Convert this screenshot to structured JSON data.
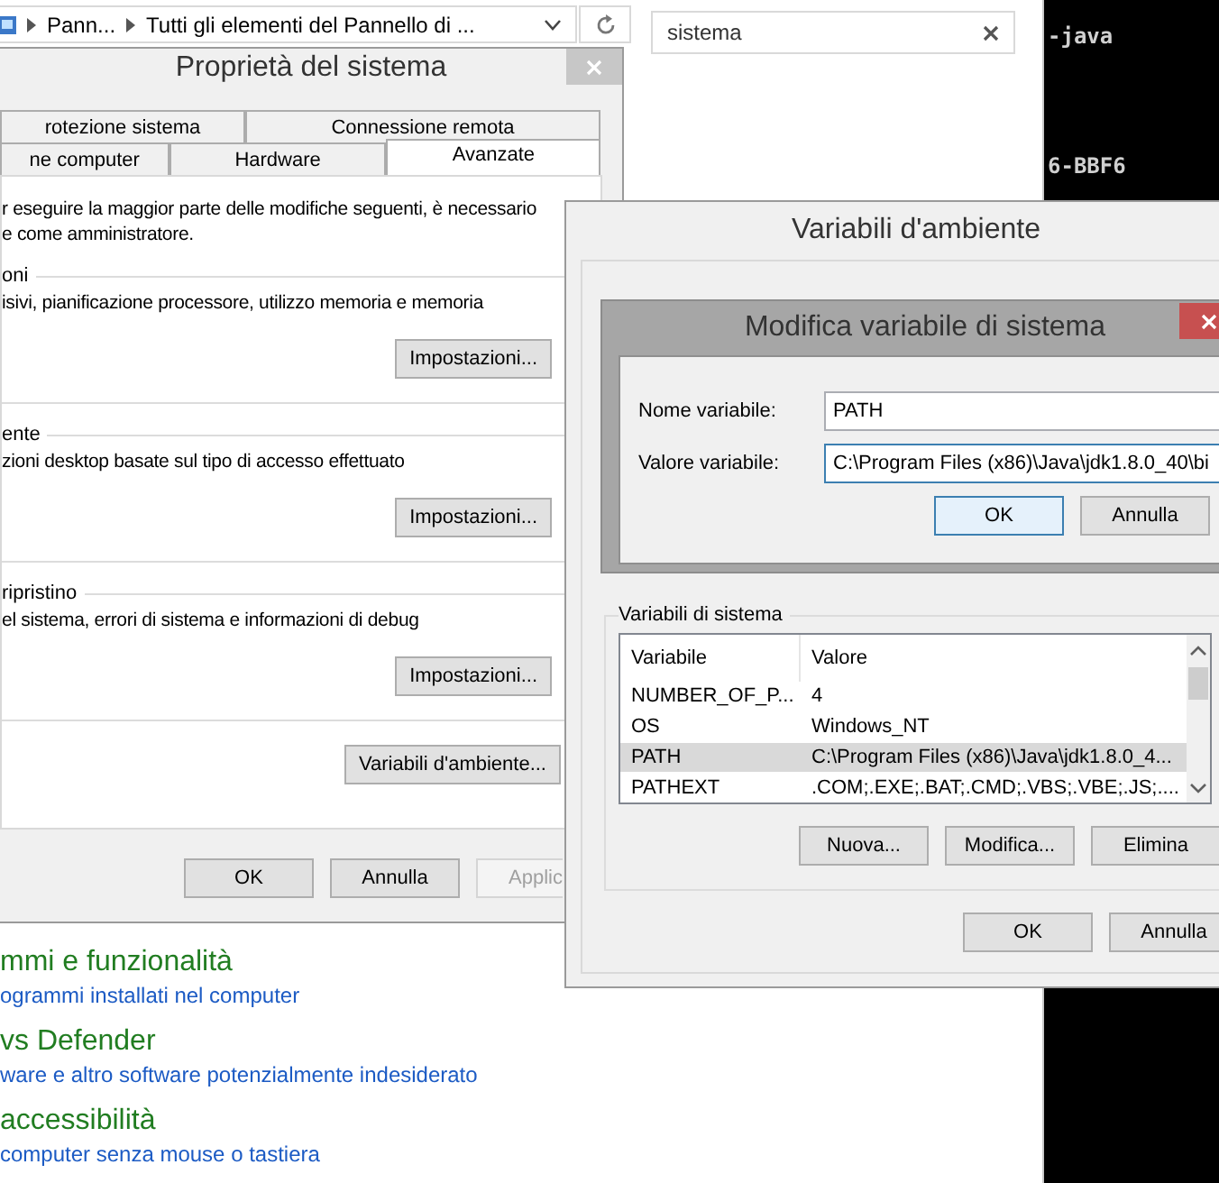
{
  "explorer": {
    "breadcrumbs": [
      "Pann...",
      "Tutti gli elementi del Pannello di ..."
    ],
    "search": {
      "value": "sistema"
    },
    "links": [
      {
        "title": "mmi e funzionalità",
        "description": "ogrammi installati nel computer"
      },
      {
        "title": "vs Defender",
        "description": "ware e altro software potenzialmente indesiderato"
      },
      {
        "title": "accessibilità",
        "description": "computer senza mouse o tastiera"
      }
    ]
  },
  "terminal": {
    "lines": [
      "-java",
      "6-BBF6"
    ]
  },
  "system_properties": {
    "title": "Proprietà del sistema",
    "tab_rows": [
      [
        {
          "label": "rotezione sistema",
          "selected": false
        },
        {
          "label": "Connessione remota",
          "selected": false
        }
      ],
      [
        {
          "label": "ne computer",
          "selected": false
        },
        {
          "label": "Hardware",
          "selected": false
        },
        {
          "label": "Avanzate",
          "selected": true
        }
      ]
    ],
    "intro_lines": [
      "r eseguire la maggior parte delle modifiche seguenti, è necessario",
      "e come amministratore."
    ],
    "groups": [
      {
        "legend": "oni",
        "text": "isivi, pianificazione processore, utilizzo memoria e memoria",
        "button": "Impostazioni..."
      },
      {
        "legend": "ente",
        "text": "zioni desktop basate sul tipo di accesso effettuato",
        "button": "Impostazioni..."
      },
      {
        "legend": "ripristino",
        "text": "el sistema, errori di sistema e informazioni di debug",
        "button": "Impostazioni..."
      }
    ],
    "env_button": "Variabili d'ambiente...",
    "footer_buttons": [
      {
        "label": "OK",
        "disabled": false
      },
      {
        "label": "Annulla",
        "disabled": false
      },
      {
        "label": "Applic",
        "disabled": true
      }
    ]
  },
  "environment_variables": {
    "title": "Variabili d'ambiente",
    "system_group": {
      "legend": "Variabili di sistema",
      "columns": [
        "Variabile",
        "Valore"
      ],
      "rows": [
        {
          "name": "NUMBER_OF_P...",
          "value": "4",
          "selected": false
        },
        {
          "name": "OS",
          "value": "Windows_NT",
          "selected": false
        },
        {
          "name": "PATH",
          "value": "C:\\Program Files (x86)\\Java\\jdk1.8.0_4...",
          "selected": true
        },
        {
          "name": "PATHEXT",
          "value": ".COM;.EXE;.BAT;.CMD;.VBS;.VBE;.JS;....",
          "selected": false
        }
      ],
      "buttons": [
        "Nuova...",
        "Modifica...",
        "Elimina"
      ]
    },
    "footer_buttons": [
      {
        "label": "OK",
        "default": false
      },
      {
        "label": "Annulla",
        "default": false
      }
    ]
  },
  "edit_dialog": {
    "title": "Modifica variabile di sistema",
    "fields": [
      {
        "label": "Nome variabile:",
        "value": "PATH",
        "focused": false
      },
      {
        "label": "Valore variabile:",
        "value": "C:\\Program Files (x86)\\Java\\jdk1.8.0_40\\bi",
        "focused": true
      }
    ],
    "buttons": [
      {
        "label": "OK",
        "default": true
      },
      {
        "label": "Annulla",
        "default": false
      }
    ]
  }
}
